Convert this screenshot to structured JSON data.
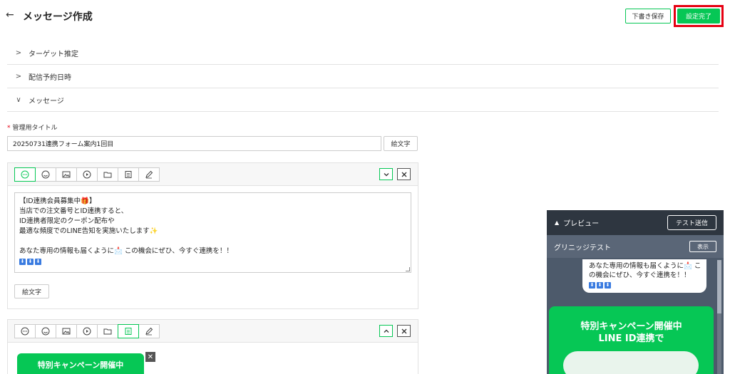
{
  "header": {
    "back_icon": "arrow-left-icon",
    "title": "メッセージ作成",
    "draft_label": "下書き保存",
    "done_label": "設定完了",
    "accent": "#06c755",
    "highlight": "#e60012"
  },
  "sections": [
    {
      "label": "ターゲット推定",
      "state": "collapsed"
    },
    {
      "label": "配信予約日時",
      "state": "collapsed"
    },
    {
      "label": "メッセージ",
      "state": "expanded"
    }
  ],
  "admin_title": {
    "label": "管理用タイトル",
    "required_mark": "*",
    "value": "20250731連携フォーム案内1回目",
    "emoji_label": "絵文字"
  },
  "message1": {
    "lines": [
      "【ID連携会員募集中🎁】",
      "当店での注文番号とID連携すると、",
      "ID連携者限定のクーポン配布や",
      "最適な頻度でのLINE告知を実施いたします✨",
      "",
      "あなた専用の情報も届くように📩 この機会にぜひ、今すぐ連携を！！"
    ],
    "arrows": [
      "⬇",
      "⬇",
      "⬇"
    ],
    "emoji_label": "絵文字"
  },
  "message2": {
    "banner_text": "特別キャンペーン開催中"
  },
  "preview": {
    "title": "プレビュー",
    "test_send_label": "テスト送信",
    "account_name": "グリニッジテスト",
    "show_label": "表示",
    "bubble_lines": [
      "あなた専用の情報も届くように📩 こ",
      "の機会にぜひ、今すぐ連携を！！"
    ],
    "bubble_arrows": [
      "⬇",
      "⬇",
      "⬇"
    ],
    "promo_line1": "特別キャンペーン開催中",
    "promo_line2": "LINE ID連携で"
  }
}
